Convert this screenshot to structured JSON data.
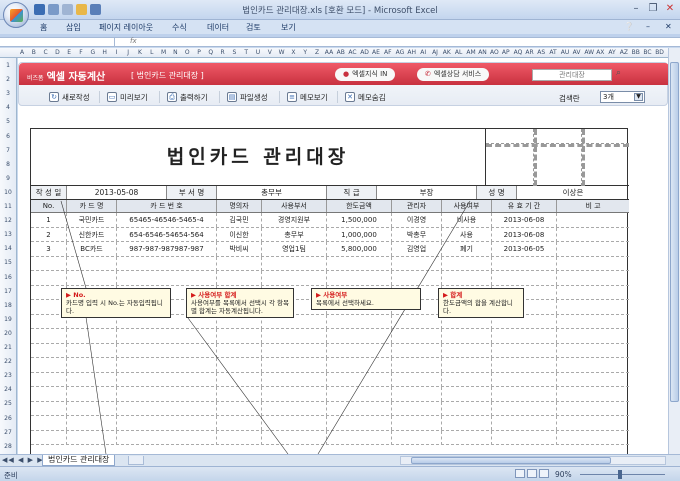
{
  "window": {
    "title": "법인카드 관리대장.xls  [호환 모드] - Microsoft Excel"
  },
  "menu": [
    "홈",
    "삽입",
    "페이지 레이아웃",
    "수식",
    "데이터",
    "검토",
    "보기"
  ],
  "formula_bar": {
    "fx": "fx"
  },
  "columns": [
    "A",
    "B",
    "C",
    "D",
    "E",
    "F",
    "G",
    "H",
    "I",
    "J",
    "K",
    "L",
    "M",
    "N",
    "O",
    "P",
    "Q",
    "R",
    "S",
    "T",
    "U",
    "V",
    "W",
    "X",
    "Y",
    "Z",
    "AA",
    "AB",
    "AC",
    "AD",
    "AE",
    "AF",
    "AG",
    "AH",
    "AI",
    "AJ",
    "AK",
    "AL",
    "AM",
    "AN",
    "AO",
    "AP",
    "AQ",
    "AR",
    "AS",
    "AT",
    "AU",
    "AV",
    "AW",
    "AX",
    "AY",
    "AZ",
    "BB",
    "BC",
    "BD"
  ],
  "rows": [
    "1",
    "2",
    "3",
    "4",
    "5",
    "6",
    "7",
    "8",
    "9",
    "10",
    "11",
    "12",
    "13",
    "14",
    "15",
    "16",
    "17",
    "18",
    "19",
    "20",
    "21",
    "22",
    "23",
    "24",
    "25",
    "26",
    "27",
    "28"
  ],
  "addin": {
    "brand_small": "비즈폼",
    "brand": "엑셀 자동계산",
    "subtitle": "[ 법인카드 관리대장 ]",
    "link1": "엑셀지식 IN",
    "link2": "엑셀상담 서비스",
    "search_placeholder": "관리대장",
    "toolbar": [
      "새로작성",
      "미리보기",
      "출력하기",
      "파일생성",
      "메모보기",
      "메모숨김"
    ],
    "count_label": "검색란",
    "count_value": "3개"
  },
  "form": {
    "title": "법인카드 관리대장",
    "writer_date_label": "작 성 일",
    "writer_date": "2013-05-08",
    "dept_label": "부 서 명",
    "dept": "총무부",
    "rank_label": "직 급",
    "rank": "부장",
    "name_label": "성 명",
    "name": "이상은",
    "headers": [
      "No.",
      "카 드 명",
      "카 드 번 호",
      "명의자",
      "사용부서",
      "한도금액",
      "관리자",
      "사용여부",
      "유 효 기 간",
      "비      고"
    ],
    "records": [
      [
        "1",
        "국민카드",
        "65465-46546-5465-4",
        "김국민",
        "경영지원부",
        "1,500,000",
        "이경영",
        "비사용",
        "2013-06-08",
        ""
      ],
      [
        "2",
        "신한카드",
        "654-6546-54654-564",
        "이신한",
        "총무부",
        "1,000,000",
        "박총무",
        "사용",
        "2013-06-08",
        ""
      ],
      [
        "3",
        "BC카드",
        "987-987-987987-987",
        "박비씨",
        "영업1팀",
        "5,800,000",
        "김영업",
        "폐기",
        "2013-06-05",
        ""
      ]
    ],
    "notes": [
      {
        "title": "▶ No.",
        "text": "카드명 입력 시 No.는 자동입력됩니다."
      },
      {
        "title": "▶ 사용여부 합계",
        "text": "사용여부를 목록에서 선택시 각 항목별 합계는 자동계산됩니다."
      },
      {
        "title": "▶ 사용여부",
        "text": "목록에서 선택하세요."
      },
      {
        "title": "▶ 합계",
        "text": "한도금액의 합을 계산합니다."
      }
    ]
  },
  "sheet_tab": "법인카드 관리대장",
  "status": {
    "text": "준비",
    "zoom": "90%"
  }
}
